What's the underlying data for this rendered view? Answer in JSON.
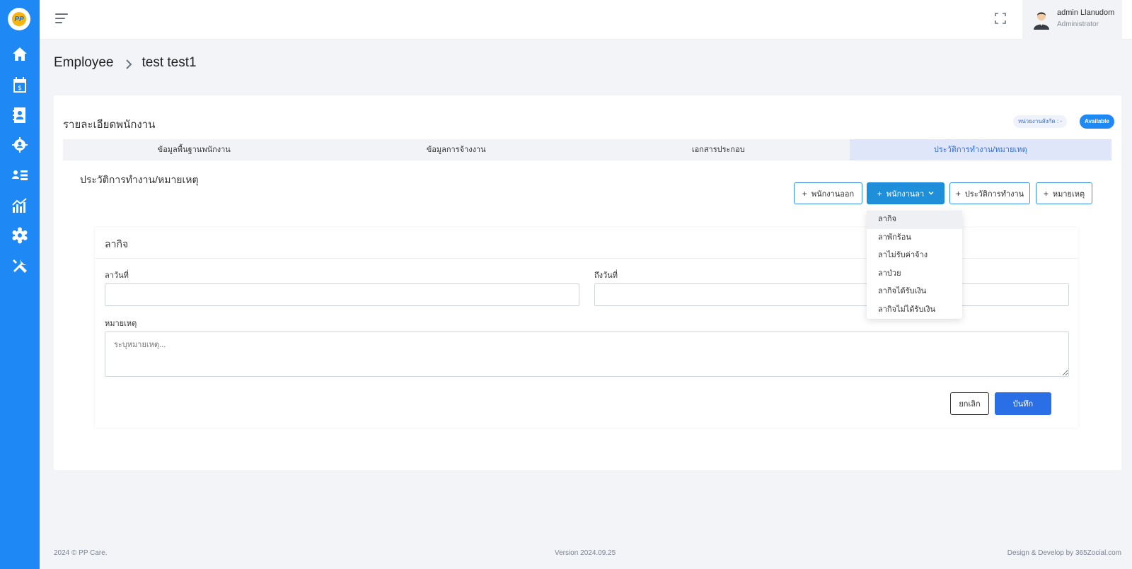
{
  "sidebar": {
    "logo_text": "PP",
    "items": [
      {
        "icon": "home-icon"
      },
      {
        "icon": "calendar-payroll-icon"
      },
      {
        "icon": "contact-book-icon"
      },
      {
        "icon": "team-gear-icon"
      },
      {
        "icon": "user-list-icon"
      },
      {
        "icon": "chart-icon"
      },
      {
        "icon": "settings-icon"
      },
      {
        "icon": "tools-icon"
      }
    ]
  },
  "topbar": {
    "user_name": "admin Llanudom",
    "user_role": "Administrator"
  },
  "breadcrumb": {
    "parent": "Employee",
    "current": "test test1"
  },
  "card": {
    "title": "รายละเอียดพนักงาน",
    "dept_badge": "หน่วยงานสังกัด : -",
    "status_badge": "Available",
    "status_color": "#1e88f5"
  },
  "tabs": [
    {
      "label": "ข้อมูลพื้นฐานพนักงาน",
      "active": false
    },
    {
      "label": "ข้อมูลการจ้างงาน",
      "active": false
    },
    {
      "label": "เอกสารประกอบ",
      "active": false
    },
    {
      "label": "ประวัติการทำงาน/หมายเหตุ",
      "active": true
    }
  ],
  "section": {
    "title": "ประวัติการทำงาน/หมายเหตุ"
  },
  "actions": {
    "resign_label": "พนักงานออก",
    "leave_label": "พนักงานลา",
    "work_history_label": "ประวัติการทำงาน",
    "note_label": "หมายเหตุ"
  },
  "leave_menu": {
    "items": [
      "ลากิจ",
      "ลาพักร้อน",
      "ลาไม่รับค่าจ้าง",
      "ลาป่วย",
      "ลากิจได้รับเงิน",
      "ลากิจไม่ได้รับเงิน"
    ],
    "hovered": 0
  },
  "form": {
    "title": "ลากิจ",
    "from_label": "ลาวันที่",
    "from_value": "",
    "to_label": "ถึงวันที่",
    "to_value": "",
    "note_label": "หมายเหตุ",
    "note_placeholder": "ระบุหมายเหตุ...",
    "cancel_label": "ยกเลิก",
    "save_label": "บันทึก"
  },
  "footer": {
    "copyright": "2024 © PP Care.",
    "version": "Version 2024.09.25",
    "credit": "Design & Develop by 365Zocial.com"
  }
}
